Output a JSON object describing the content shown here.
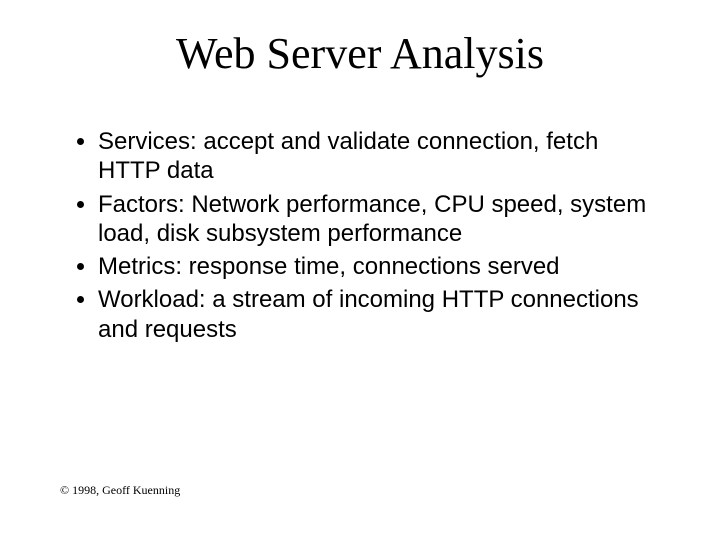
{
  "title": "Web Server Analysis",
  "bullets": [
    "Services: accept and validate connection, fetch HTTP data",
    "Factors: Network performance, CPU speed, system load, disk subsystem performance",
    "Metrics: response time, connections served",
    "Workload: a stream of incoming HTTP connections and requests"
  ],
  "footer": "© 1998, Geoff Kuenning"
}
